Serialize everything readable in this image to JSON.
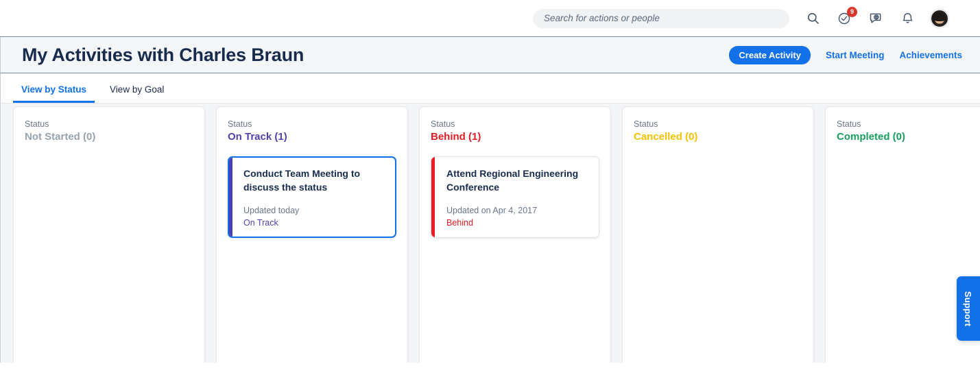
{
  "topbar": {
    "search": {
      "placeholder": "Search for actions or people",
      "value": ""
    },
    "icons": [
      {
        "name": "search-icon",
        "label": "Search"
      },
      {
        "name": "tasks-check-icon",
        "label": "Tasks",
        "badge": "9"
      },
      {
        "name": "feedback-chat-icon",
        "label": "Feedback"
      },
      {
        "name": "notifications-bell-icon",
        "label": "Notifications"
      }
    ],
    "avatar_alt": "User profile"
  },
  "header": {
    "title": "My Activities with Charles Braun",
    "create_activity_label": "Create Activity",
    "start_meeting_label": "Start Meeting",
    "achievements_label": "Achievements"
  },
  "tabs": [
    {
      "label": "View by Status",
      "active": true
    },
    {
      "label": "View by Goal",
      "active": false
    }
  ],
  "board": {
    "status_caption": "Status",
    "columns": [
      {
        "status_label": "Not Started (0)",
        "status_color": "#9aa3ad",
        "cards": []
      },
      {
        "status_label": "On Track (1)",
        "status_color": "#5243aa",
        "cards": [
          {
            "title": "Conduct Team Meeting to discuss the status",
            "updated": "Updated today",
            "status": "On Track",
            "status_color": "#5243aa",
            "accent_color": "#4a3fb5",
            "selected": true
          }
        ]
      },
      {
        "status_label": "Behind (1)",
        "status_color": "#e01c23",
        "cards": [
          {
            "title": "Attend Regional Engineering Conference",
            "updated": "Updated on Apr 4, 2017",
            "status": "Behind",
            "status_color": "#e01c23",
            "accent_color": "#ed1b24",
            "selected": false
          }
        ]
      },
      {
        "status_label": "Cancelled (0)",
        "status_color": "#f2c200",
        "cards": []
      },
      {
        "status_label": "Completed (0)",
        "status_color": "#19a05e",
        "cards": []
      }
    ]
  },
  "support": {
    "label": "Support"
  }
}
